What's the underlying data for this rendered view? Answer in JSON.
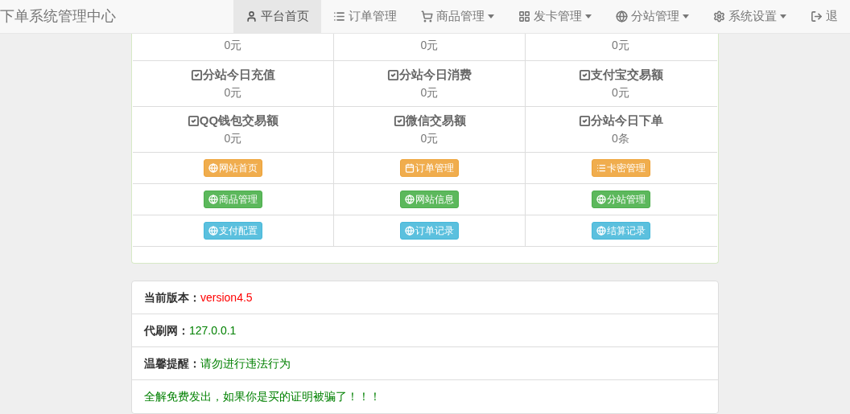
{
  "navbar": {
    "brand": "下单系统管理中心",
    "items": [
      {
        "label": "平台首页",
        "dropdown": false,
        "selected": true
      },
      {
        "label": "订单管理",
        "dropdown": false,
        "selected": false
      },
      {
        "label": "商品管理",
        "dropdown": true,
        "selected": false
      },
      {
        "label": "发卡管理",
        "dropdown": true,
        "selected": false
      },
      {
        "label": "分站管理",
        "dropdown": true,
        "selected": false
      },
      {
        "label": "系统设置",
        "dropdown": true,
        "selected": false
      },
      {
        "label": "退",
        "dropdown": false,
        "selected": false
      }
    ]
  },
  "stats": {
    "partial_row": [
      "0元",
      "0元",
      "0元"
    ],
    "rows": [
      [
        {
          "label": "分站今日充值",
          "value": "0元"
        },
        {
          "label": "分站今日消费",
          "value": "0元"
        },
        {
          "label": "支付宝交易额",
          "value": "0元"
        }
      ],
      [
        {
          "label": "QQ钱包交易额",
          "value": "0元"
        },
        {
          "label": "微信交易额",
          "value": "0元"
        },
        {
          "label": "分站今日下单",
          "value": "0条"
        }
      ]
    ]
  },
  "shortcuts": [
    [
      {
        "label": "网站首页",
        "kind": "warning"
      },
      {
        "label": "订单管理",
        "kind": "warning"
      },
      {
        "label": "卡密管理",
        "kind": "warning"
      }
    ],
    [
      {
        "label": "商品管理",
        "kind": "success"
      },
      {
        "label": "网站信息",
        "kind": "success"
      },
      {
        "label": "分站管理",
        "kind": "success"
      }
    ],
    [
      {
        "label": "支付配置",
        "kind": "info"
      },
      {
        "label": "订单记录",
        "kind": "info"
      },
      {
        "label": "结算记录",
        "kind": "info"
      }
    ]
  ],
  "info": [
    {
      "kind": "pair",
      "label": "当前版本：",
      "value": "version4.5",
      "color": "#ff0000"
    },
    {
      "kind": "pair",
      "label": "代刷网：",
      "value": "127.0.0.1",
      "color": "#008000"
    },
    {
      "kind": "pair",
      "label": "温馨提醒：",
      "value": "请勿进行违法行为",
      "color": "#008000"
    },
    {
      "kind": "note",
      "value": "全解免费发出，如果你是买的证明被骗了！！！",
      "color": "#008000"
    }
  ]
}
